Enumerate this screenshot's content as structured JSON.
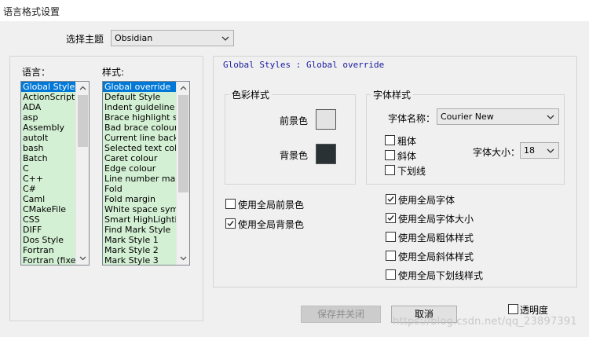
{
  "window": {
    "title": "语言格式设置"
  },
  "theme": {
    "label": "选择主题",
    "value": "Obsidian"
  },
  "languages": {
    "label": "语言：",
    "items": [
      "Global Styles",
      "ActionScript",
      "ADA",
      "asp",
      "Assembly",
      "autoIt",
      "bash",
      "Batch",
      "C",
      "C++",
      "C#",
      "Caml",
      "CMakeFile",
      "CSS",
      "DIFF",
      "Dos Style",
      "Fortran",
      "Fortran (fixed"
    ],
    "selected": "Global Styles"
  },
  "styles": {
    "label": "样式:",
    "items": [
      "Global override",
      "Default Style",
      "Indent guideline sty",
      "Brace highlight style",
      "Bad brace colour",
      "Current line backgr",
      "Selected text colou",
      "Caret colour",
      "Edge colour",
      "Line number margin",
      "Fold",
      "Fold margin",
      "White space symbo",
      "Smart HighLighting",
      "Find Mark Style",
      "Mark Style 1",
      "Mark Style 2",
      "Mark Style 3"
    ],
    "selected": "Global override"
  },
  "header_path": "Global Styles : Global override",
  "color_group": {
    "title": "色彩样式",
    "fg_label": "前景色",
    "bg_label": "背景色",
    "fg_color": "#e3e3e3",
    "bg_color": "#293134"
  },
  "font_group": {
    "title": "字体样式",
    "name_label": "字体名称：",
    "name_value": "Courier New",
    "bold_label": "粗体",
    "italic_label": "斜体",
    "underline_label": "下划线",
    "size_label": "字体大小：",
    "size_value": "18"
  },
  "global_options": {
    "use_global_fg": {
      "label": "使用全局前景色",
      "checked": false
    },
    "use_global_bg": {
      "label": "使用全局背景色",
      "checked": true
    },
    "use_global_font": {
      "label": "使用全局字体",
      "checked": true
    },
    "use_global_font_size": {
      "label": "使用全局字体大小",
      "checked": true
    },
    "use_global_bold": {
      "label": "使用全局粗体样式",
      "checked": false
    },
    "use_global_italic": {
      "label": "使用全局斜体样式",
      "checked": false
    },
    "use_global_underline": {
      "label": "使用全局下划线样式",
      "checked": false
    }
  },
  "buttons": {
    "save_close": "保存并关闭",
    "cancel": "取消"
  },
  "transparency": {
    "label": "透明度",
    "checked": false
  },
  "watermark": "https://blog.csdn.net/qq_23897391"
}
